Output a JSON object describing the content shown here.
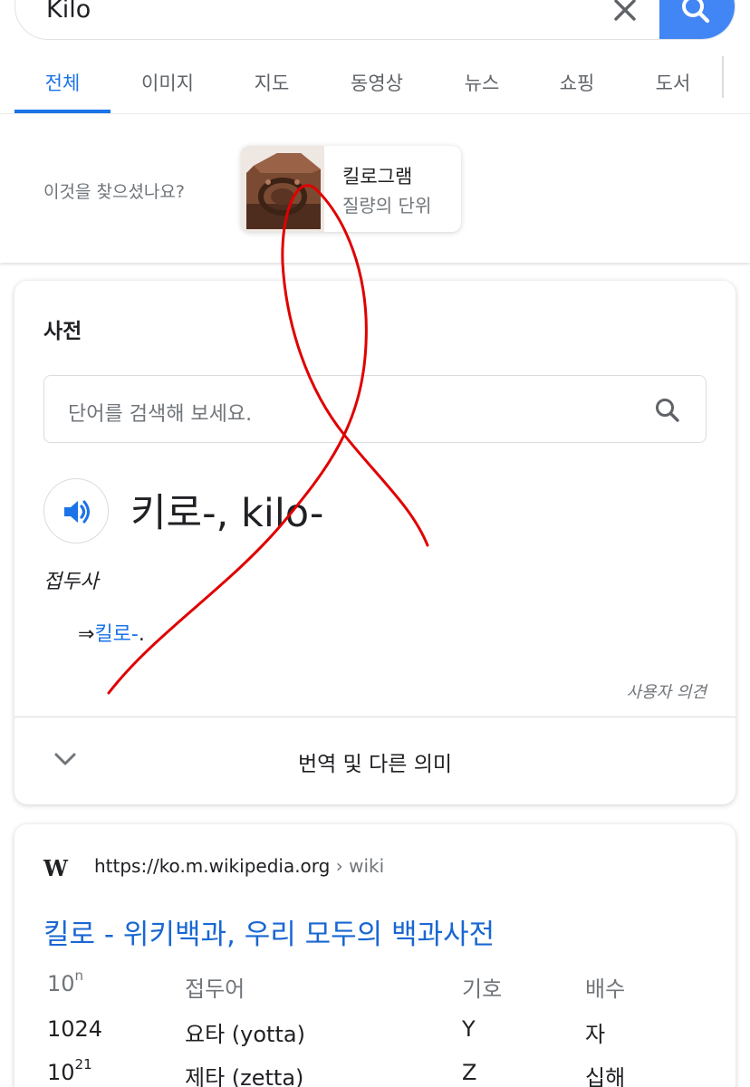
{
  "search": {
    "query": "Kilo"
  },
  "tabs": [
    {
      "label": "전체",
      "active": true
    },
    {
      "label": "이미지"
    },
    {
      "label": "지도"
    },
    {
      "label": "동영상"
    },
    {
      "label": "뉴스"
    },
    {
      "label": "쇼핑"
    },
    {
      "label": "도서"
    }
  ],
  "did_you_mean": {
    "label": "이것을 찾으셨나요?",
    "card_title": "킬로그램",
    "card_subtitle": "질량의 단위"
  },
  "dictionary": {
    "heading": "사전",
    "search_placeholder": "단어를 검색해 보세요.",
    "word": "키로-, kilo-",
    "part_of_speech": "접두사",
    "definition_arrow": "⇒",
    "definition_link": "킬로-",
    "definition_suffix": ".",
    "feedback": "사용자 의견",
    "more_label": "번역 및 다른 의미"
  },
  "wiki_result": {
    "site_logo": "W",
    "url": "https://ko.m.wikipedia.org",
    "breadcrumb": " › wiki",
    "title": "킬로 - 위키백과, 우리 모두의 백과사전",
    "table": {
      "headers": {
        "n_base": "10",
        "n_exp": "n",
        "prefix": "접두어",
        "symbol": "기호",
        "multiple": "배수"
      },
      "rows": [
        {
          "power": "1024",
          "exp": "",
          "prefix": "요타 (yotta)",
          "symbol": "Y",
          "multiple": "자"
        },
        {
          "power": "10",
          "exp": "21",
          "prefix": "제타 (zetta)",
          "symbol": "Z",
          "multiple": "십해"
        }
      ]
    }
  },
  "colors": {
    "accent_blue": "#1a73e8",
    "search_button": "#4285f4",
    "scribble_red": "#e00000"
  }
}
